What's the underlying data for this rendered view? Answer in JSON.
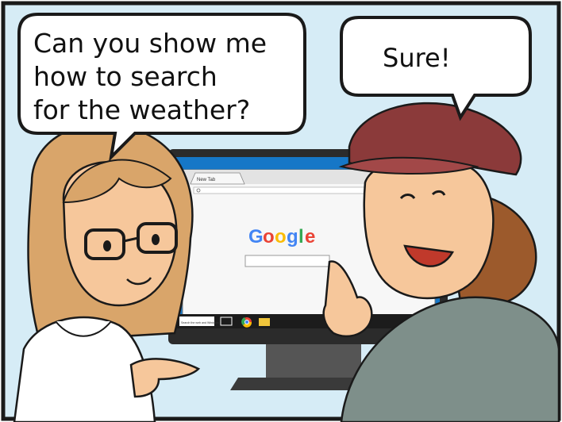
{
  "bubble_left": {
    "line1": "Can you show me",
    "line2": "how to search",
    "line3": "for the weather?"
  },
  "bubble_right": {
    "text": "Sure!"
  },
  "browser": {
    "tab_label": "New Tab",
    "logo": [
      "G",
      "o",
      "o",
      "g",
      "l",
      "e"
    ],
    "logo_colors": [
      "#4285F4",
      "#EA4335",
      "#FBBC05",
      "#4285F4",
      "#34A853",
      "#EA4335"
    ]
  },
  "taskbar": {
    "search_text": "Search the web and Windows"
  },
  "colors": {
    "sky": "#d6ecf6",
    "border": "#1a1a1a",
    "hat": "#8b3a3a",
    "hair_left": "#d9a56a",
    "hair_right": "#9c5a2c",
    "skin": "#f6c79b",
    "jacket": "#7e8f8a",
    "monitor": "#2b2b2b",
    "screen_blue": "#1677c7"
  }
}
